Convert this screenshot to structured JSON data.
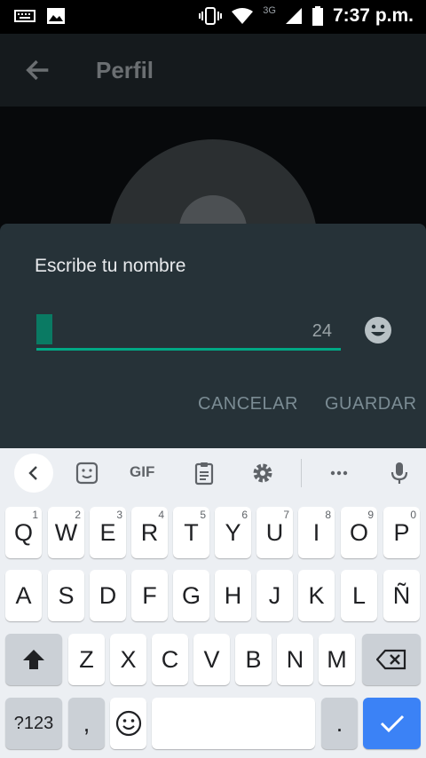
{
  "status_bar": {
    "network_type": "3G",
    "time": "7:37 p.m."
  },
  "app_bar": {
    "title": "Perfil"
  },
  "dialog": {
    "title": "Escribe tu nombre",
    "name_value": "",
    "char_counter": "24",
    "cancel_label": "CANCELAR",
    "save_label": "GUARDAR"
  },
  "keyboard": {
    "toolbar": {
      "gif_label": "GIF"
    },
    "row1": [
      {
        "label": "Q",
        "hint": "1"
      },
      {
        "label": "W",
        "hint": "2"
      },
      {
        "label": "E",
        "hint": "3"
      },
      {
        "label": "R",
        "hint": "4"
      },
      {
        "label": "T",
        "hint": "5"
      },
      {
        "label": "Y",
        "hint": "6"
      },
      {
        "label": "U",
        "hint": "7"
      },
      {
        "label": "I",
        "hint": "8"
      },
      {
        "label": "O",
        "hint": "9"
      },
      {
        "label": "P",
        "hint": "0"
      }
    ],
    "row2": [
      "A",
      "S",
      "D",
      "F",
      "G",
      "H",
      "J",
      "K",
      "L",
      "Ñ"
    ],
    "row3": [
      "Z",
      "X",
      "C",
      "V",
      "B",
      "N",
      "M"
    ],
    "symbols_label": "?123",
    "comma_label": ",",
    "period_label": "."
  },
  "colors": {
    "accent": "#00a884",
    "dialog_bg": "#263238",
    "action_key": "#3b82f6"
  }
}
